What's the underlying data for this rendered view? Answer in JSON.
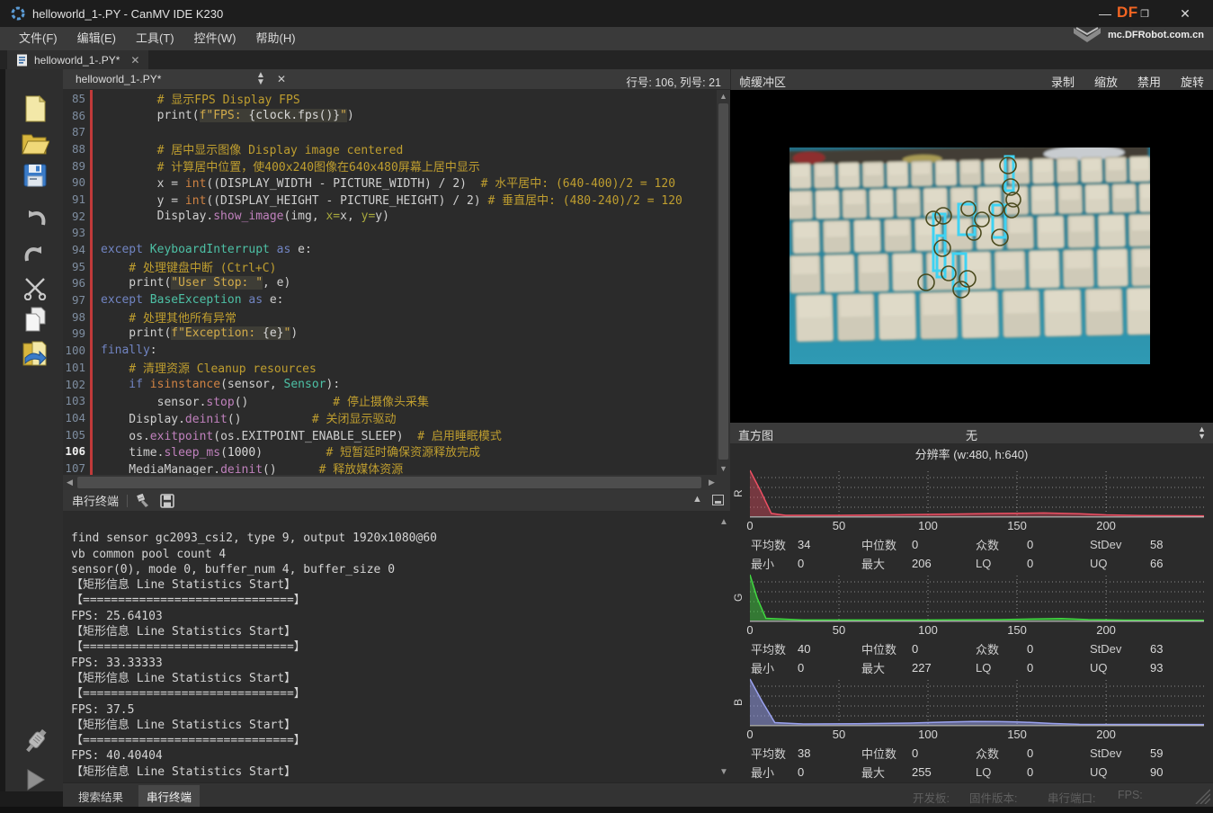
{
  "window": {
    "title": "helloworld_1-.PY - CanMV IDE K230"
  },
  "menu": {
    "items": [
      "文件(F)",
      "编辑(E)",
      "工具(T)",
      "控件(W)",
      "帮助(H)"
    ]
  },
  "branding": {
    "df": "DF",
    "site": "mc.DFRobot.com.cn",
    "accent": "#f26522"
  },
  "tab": {
    "label": "helloworld_1-.PY*"
  },
  "editor": {
    "selector_label": "helloworld_1-.PY*",
    "cursor_status": "行号: 106, 列号: 21",
    "current_line": 106,
    "lines": [
      {
        "no": 85,
        "spans": [
          [
            "cmt",
            "        # 显示FPS Display FPS"
          ]
        ]
      },
      {
        "no": 86,
        "spans": [
          [
            "plain",
            "        print("
          ],
          [
            "str",
            "f\"FPS: "
          ],
          [
            "interp",
            "{clock.fps()}"
          ],
          [
            "str",
            "\""
          ],
          [
            "plain",
            ")"
          ]
        ]
      },
      {
        "no": 87,
        "spans": []
      },
      {
        "no": 88,
        "spans": [
          [
            "cmt",
            "        # 居中显示图像 Display image centered"
          ]
        ]
      },
      {
        "no": 89,
        "spans": [
          [
            "cmt",
            "        # 计算居中位置，使400x240图像在640x480屏幕上居中显示"
          ]
        ]
      },
      {
        "no": 90,
        "spans": [
          [
            "plain",
            "        x = "
          ],
          [
            "fn",
            "int"
          ],
          [
            "plain",
            "((DISPLAY_WIDTH - PICTURE_WIDTH) / 2)  "
          ],
          [
            "cmt",
            "# 水平居中: (640-400)/2 = 120"
          ]
        ]
      },
      {
        "no": 91,
        "spans": [
          [
            "plain",
            "        y = "
          ],
          [
            "fn",
            "int"
          ],
          [
            "plain",
            "((DISPLAY_HEIGHT - PICTURE_HEIGHT) / 2) "
          ],
          [
            "cmt",
            "# 垂直居中: (480-240)/2 = 120"
          ]
        ]
      },
      {
        "no": 92,
        "spans": [
          [
            "plain",
            "        Display."
          ],
          [
            "meth",
            "show_image"
          ],
          [
            "plain",
            "(img, "
          ],
          [
            "kwarg",
            "x="
          ],
          [
            "plain",
            "x, "
          ],
          [
            "kwarg",
            "y="
          ],
          [
            "plain",
            "y)"
          ]
        ]
      },
      {
        "no": 93,
        "spans": []
      },
      {
        "no": 94,
        "spans": [
          [
            "kw",
            "except "
          ],
          [
            "cls",
            "KeyboardInterrupt"
          ],
          [
            "kw",
            " as "
          ],
          [
            "plain",
            "e:"
          ]
        ]
      },
      {
        "no": 95,
        "spans": [
          [
            "cmt",
            "    # 处理键盘中断 (Ctrl+C)"
          ]
        ]
      },
      {
        "no": 96,
        "spans": [
          [
            "plain",
            "    print("
          ],
          [
            "str",
            "\"User Stop: \""
          ],
          [
            "plain",
            ", e)"
          ]
        ]
      },
      {
        "no": 97,
        "spans": [
          [
            "kw",
            "except "
          ],
          [
            "cls",
            "BaseException"
          ],
          [
            "kw",
            " as "
          ],
          [
            "plain",
            "e:"
          ]
        ]
      },
      {
        "no": 98,
        "spans": [
          [
            "cmt",
            "    # 处理其他所有异常"
          ]
        ]
      },
      {
        "no": 99,
        "spans": [
          [
            "plain",
            "    print("
          ],
          [
            "str",
            "f\"Exception: "
          ],
          [
            "interp",
            "{e}"
          ],
          [
            "str",
            "\""
          ],
          [
            "plain",
            ")"
          ]
        ]
      },
      {
        "no": 100,
        "spans": [
          [
            "kw",
            "finally"
          ],
          [
            "plain",
            ":"
          ]
        ]
      },
      {
        "no": 101,
        "spans": [
          [
            "cmt",
            "    # 清理资源 Cleanup resources"
          ]
        ]
      },
      {
        "no": 102,
        "spans": [
          [
            "kw",
            "    if "
          ],
          [
            "fn",
            "isinstance"
          ],
          [
            "plain",
            "(sensor, "
          ],
          [
            "cls",
            "Sensor"
          ],
          [
            "plain",
            "):"
          ]
        ]
      },
      {
        "no": 103,
        "spans": [
          [
            "plain",
            "        sensor."
          ],
          [
            "meth",
            "stop"
          ],
          [
            "plain",
            "()            "
          ],
          [
            "cmt",
            "# 停止摄像头采集"
          ]
        ]
      },
      {
        "no": 104,
        "spans": [
          [
            "plain",
            "    Display."
          ],
          [
            "meth",
            "deinit"
          ],
          [
            "plain",
            "()          "
          ],
          [
            "cmt",
            "# 关闭显示驱动"
          ]
        ]
      },
      {
        "no": 105,
        "spans": [
          [
            "plain",
            "    os."
          ],
          [
            "meth",
            "exitpoint"
          ],
          [
            "plain",
            "(os.EXITPOINT_ENABLE_SLEEP)  "
          ],
          [
            "cmt",
            "# 启用睡眠模式"
          ]
        ]
      },
      {
        "no": 106,
        "spans": [
          [
            "plain",
            "    time."
          ],
          [
            "meth",
            "sleep_ms"
          ],
          [
            "plain",
            "("
          ],
          [
            "num",
            "1000"
          ],
          [
            "plain",
            ")         "
          ],
          [
            "cmt",
            "# 短暂延时确保资源释放完成"
          ]
        ]
      },
      {
        "no": 107,
        "spans": [
          [
            "plain",
            "    MediaManager."
          ],
          [
            "meth",
            "deinit"
          ],
          [
            "plain",
            "()      "
          ],
          [
            "cmt",
            "# 释放媒体资源"
          ]
        ]
      }
    ]
  },
  "framebuffer": {
    "title": "帧缓冲区",
    "buttons": [
      "录制",
      "缩放",
      "禁用",
      "旋转"
    ],
    "annotation_rect_color": "#3fd2f2",
    "annotation_circle_color": "#4a4a1e"
  },
  "histogram": {
    "panel_title": "直方图",
    "mode": "无",
    "resolution": "分辨率 (w:480, h:640)",
    "value_max": 255,
    "ticks": [
      0,
      50,
      100,
      150,
      200
    ],
    "channels": [
      {
        "label": "R",
        "color": "#ee4f63",
        "fill": "rgba(238,79,99,0.38)",
        "curve": [
          [
            0,
            1
          ],
          [
            6,
            0.55
          ],
          [
            12,
            0.06
          ],
          [
            20,
            0.02
          ],
          [
            50,
            0.02
          ],
          [
            80,
            0.03
          ],
          [
            110,
            0.045
          ],
          [
            140,
            0.06
          ],
          [
            165,
            0.07
          ],
          [
            185,
            0.055
          ],
          [
            200,
            0.03
          ],
          [
            220,
            0.015
          ],
          [
            245,
            0.01
          ],
          [
            255,
            0.008
          ]
        ],
        "stats": [
          [
            "平均数",
            "34"
          ],
          [
            "中位数",
            "0"
          ],
          [
            "众数",
            "0"
          ],
          [
            "StDev",
            "58"
          ],
          [
            "最小",
            "0"
          ],
          [
            "最大",
            "206"
          ],
          [
            "LQ",
            "0"
          ],
          [
            "UQ",
            "66"
          ]
        ]
      },
      {
        "label": "G",
        "color": "#41d941",
        "fill": "rgba(65,217,65,0.45)",
        "curve": [
          [
            0,
            1
          ],
          [
            4,
            0.5
          ],
          [
            9,
            0.05
          ],
          [
            30,
            0.012
          ],
          [
            100,
            0.012
          ],
          [
            140,
            0.02
          ],
          [
            160,
            0.035
          ],
          [
            175,
            0.045
          ],
          [
            190,
            0.02
          ],
          [
            210,
            0.01
          ],
          [
            255,
            0.008
          ]
        ],
        "stats": [
          [
            "平均数",
            "40"
          ],
          [
            "中位数",
            "0"
          ],
          [
            "众数",
            "0"
          ],
          [
            "StDev",
            "63"
          ],
          [
            "最小",
            "0"
          ],
          [
            "最大",
            "227"
          ],
          [
            "LQ",
            "0"
          ],
          [
            "UQ",
            "93"
          ]
        ]
      },
      {
        "label": "B",
        "color": "#9aa2ef",
        "fill": "rgba(154,162,239,0.5)",
        "curve": [
          [
            0,
            1
          ],
          [
            7,
            0.5
          ],
          [
            14,
            0.05
          ],
          [
            30,
            0.02
          ],
          [
            60,
            0.025
          ],
          [
            90,
            0.04
          ],
          [
            110,
            0.06
          ],
          [
            125,
            0.075
          ],
          [
            140,
            0.07
          ],
          [
            150,
            0.065
          ],
          [
            160,
            0.05
          ],
          [
            170,
            0.03
          ],
          [
            185,
            0.012
          ],
          [
            255,
            0.008
          ]
        ],
        "stats": [
          [
            "平均数",
            "38"
          ],
          [
            "中位数",
            "0"
          ],
          [
            "众数",
            "0"
          ],
          [
            "StDev",
            "59"
          ],
          [
            "最小",
            "0"
          ],
          [
            "最大",
            "255"
          ],
          [
            "LQ",
            "0"
          ],
          [
            "UQ",
            "90"
          ]
        ]
      }
    ]
  },
  "terminal": {
    "title": "串行终端",
    "lines": [
      "",
      "find sensor gc2093_csi2, type 9, output 1920x1080@60",
      "vb common pool count 4",
      "sensor(0), mode 0, buffer_num 4, buffer_size 0",
      "【矩形信息 Line Statistics Start】",
      "【==============================】",
      "FPS: 25.64103",
      "【矩形信息 Line Statistics Start】",
      "【==============================】",
      "FPS: 33.33333",
      "【矩形信息 Line Statistics Start】",
      "【==============================】",
      "FPS: 37.5",
      "【矩形信息 Line Statistics Start】",
      "【==============================】",
      "FPS: 40.40404",
      "【矩形信息 Line Statistics Start】"
    ]
  },
  "statusbar": {
    "tabs": [
      "搜索结果",
      "串行终端"
    ],
    "active_tab_index": 1,
    "labels": [
      "开发板:",
      "固件版本:",
      "串行端口:",
      "FPS:"
    ]
  }
}
